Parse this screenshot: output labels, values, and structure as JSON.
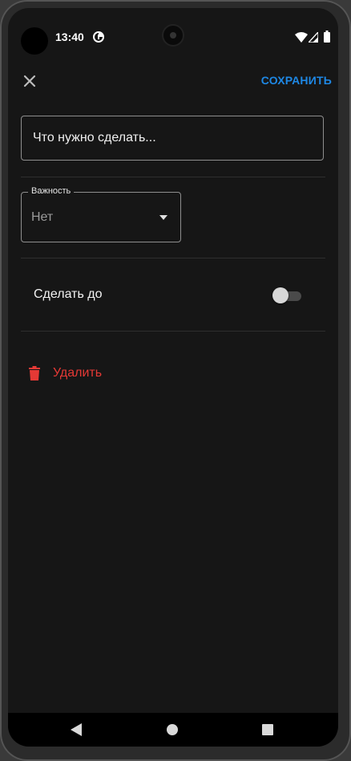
{
  "status_bar": {
    "time": "13:40",
    "icons": [
      "data-saver-icon",
      "wifi-icon",
      "signal-icon",
      "battery-icon"
    ]
  },
  "header": {
    "close_icon": "close-icon",
    "save_label": "СОХРАНИТЬ"
  },
  "task": {
    "placeholder": "Что нужно сделать...",
    "value": ""
  },
  "priority": {
    "label": "Важность",
    "selected": "Нет"
  },
  "deadline": {
    "label": "Сделать до",
    "enabled": false
  },
  "delete": {
    "label": "Удалить",
    "icon": "trash-icon"
  },
  "nav_bar": {
    "icons": [
      "back-icon",
      "home-icon",
      "recents-icon"
    ]
  },
  "colors": {
    "background": "#161616",
    "accent": "#1e88e5",
    "danger": "#e53935",
    "text": "#ffffff",
    "secondary_text": "#9a9a9a"
  }
}
